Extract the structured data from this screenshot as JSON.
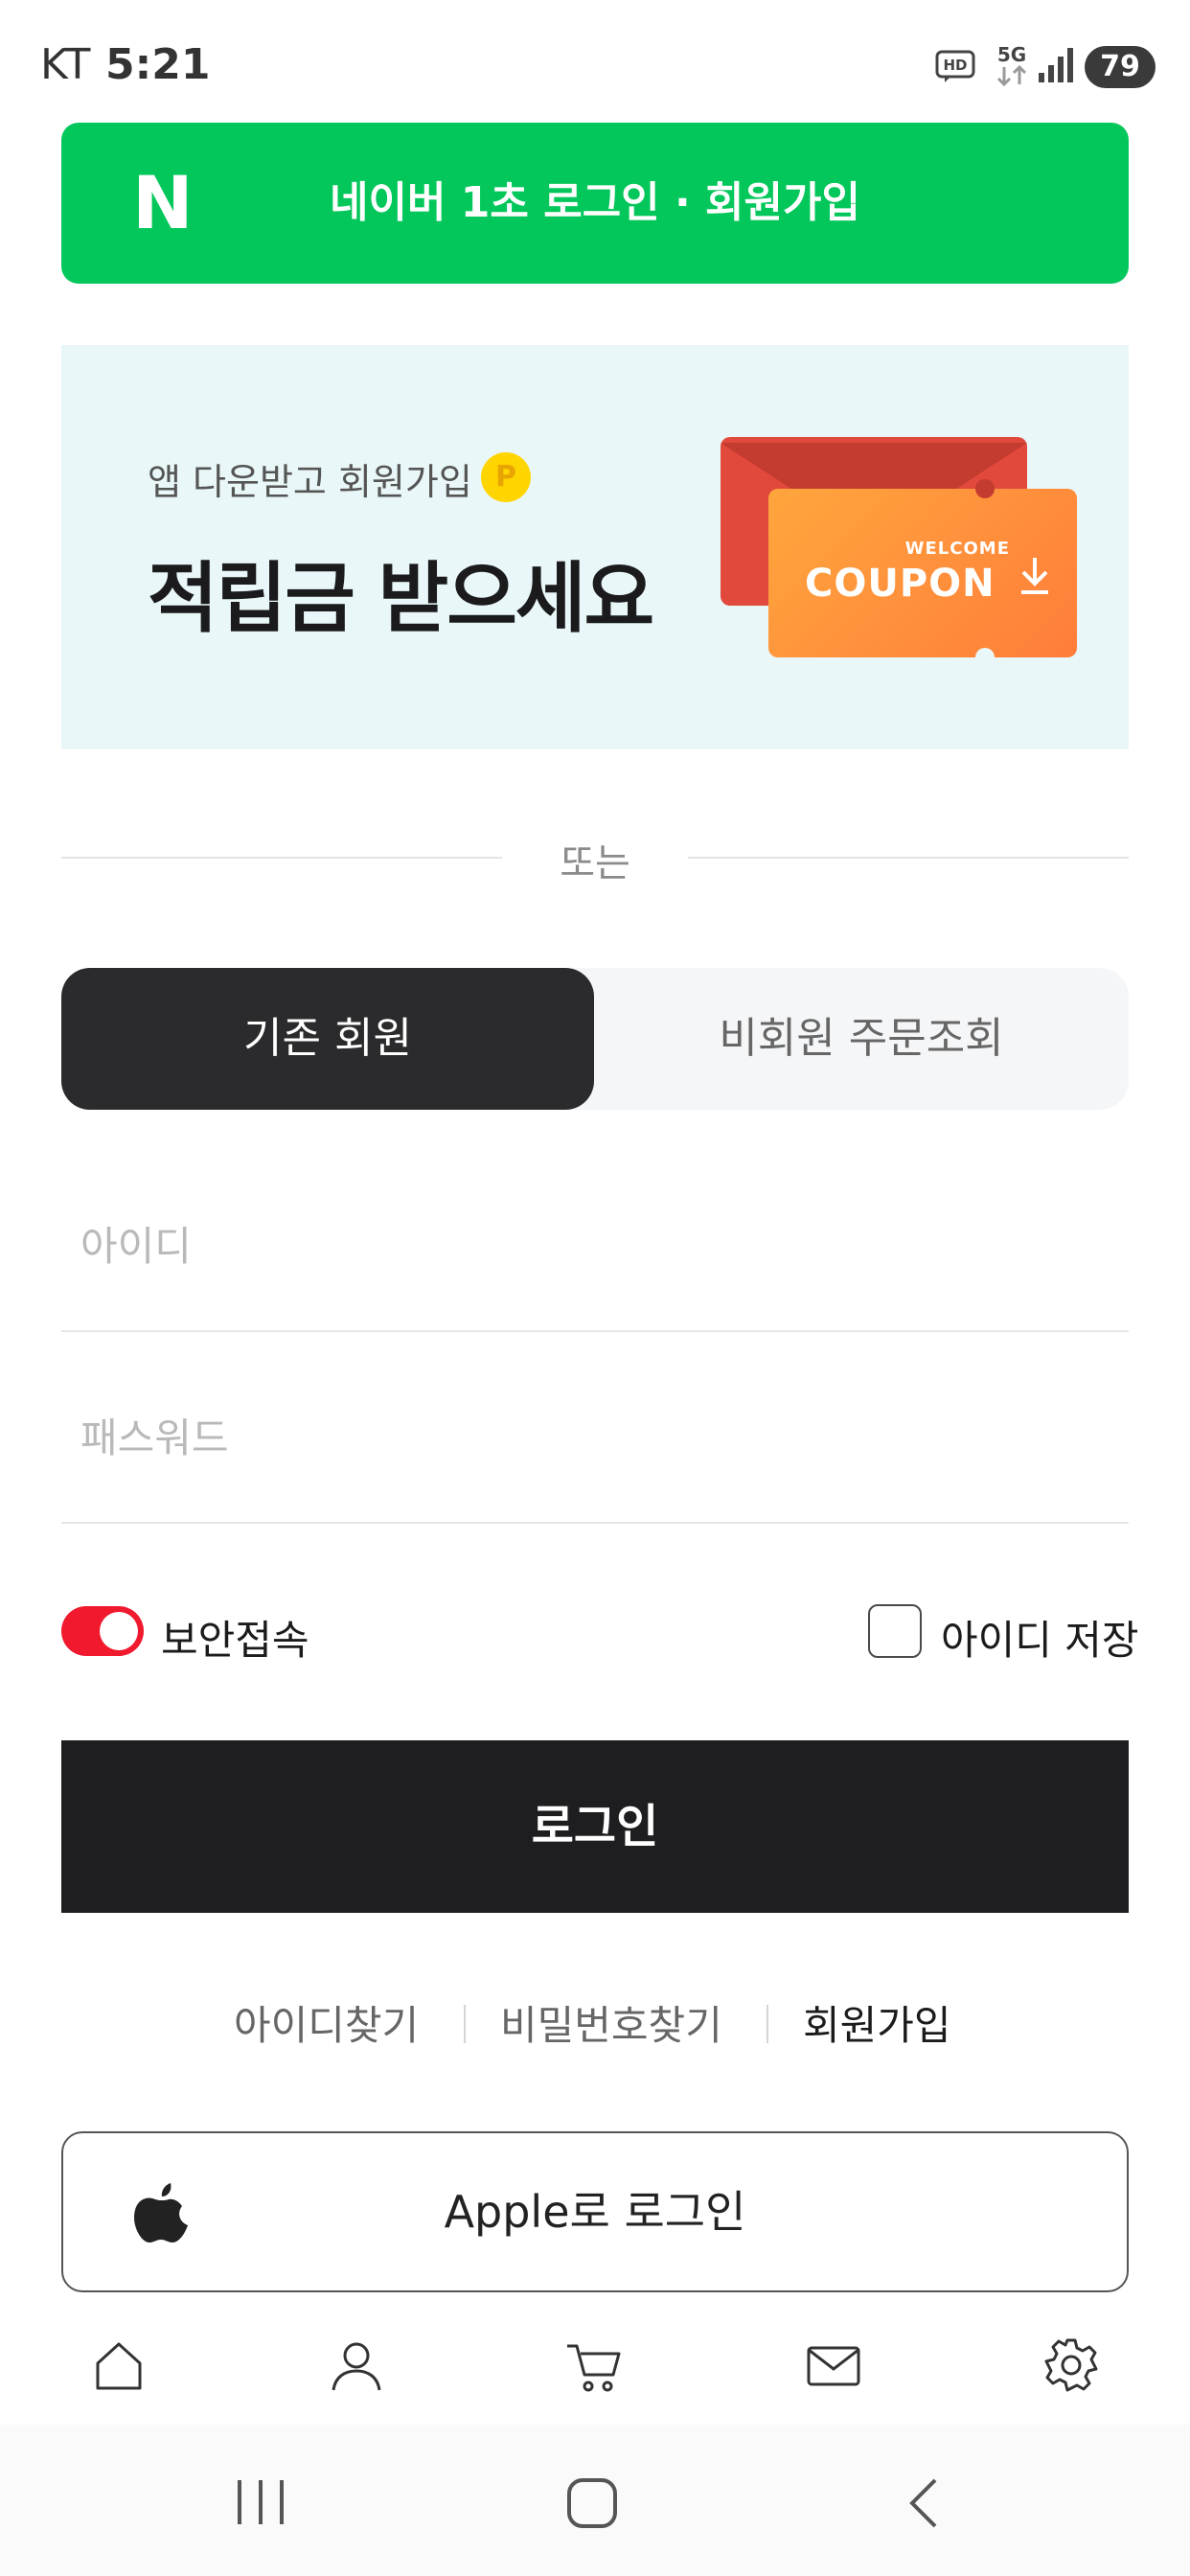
{
  "status_bar": {
    "carrier": "KT",
    "time": "5:21",
    "hd_label": "HD",
    "network": "5G",
    "battery": "79"
  },
  "naver_login": {
    "logo": "N",
    "label": "네이버 1초 로그인 · 회원가입",
    "color": "#03c75a"
  },
  "banner": {
    "subtitle": "앱 다운받고 회원가입",
    "point_badge": "P",
    "headline": "적립금 받으세요",
    "coupon_small": "WELCOME",
    "coupon_main": "COUPON"
  },
  "divider": {
    "or_text": "또는"
  },
  "tabs": [
    {
      "label": "기존 회원",
      "active": true
    },
    {
      "label": "비회원 주문조회",
      "active": false
    }
  ],
  "form": {
    "id_placeholder": "아이디",
    "id_value": "",
    "password_placeholder": "패스워드",
    "password_value": "",
    "secure_login_label": "보안접속",
    "secure_login_on": true,
    "save_id_label": "아이디 저장",
    "save_id_checked": false,
    "login_button": "로그인"
  },
  "links": {
    "find_id": "아이디찾기",
    "find_password": "비밀번호찾기",
    "join": "회원가입"
  },
  "apple_login": {
    "label": "Apple로 로그인",
    "icon": "apple-icon"
  },
  "bottom_nav": [
    "home-icon",
    "user-icon",
    "cart-icon",
    "mail-icon",
    "gear-icon"
  ],
  "system_nav": [
    "recent-apps-icon",
    "home-button-icon",
    "back-icon"
  ],
  "colors": {
    "accent_red": "#f0192d",
    "dark": "#1e1e20",
    "banner_bg": "#e9f7f8"
  }
}
